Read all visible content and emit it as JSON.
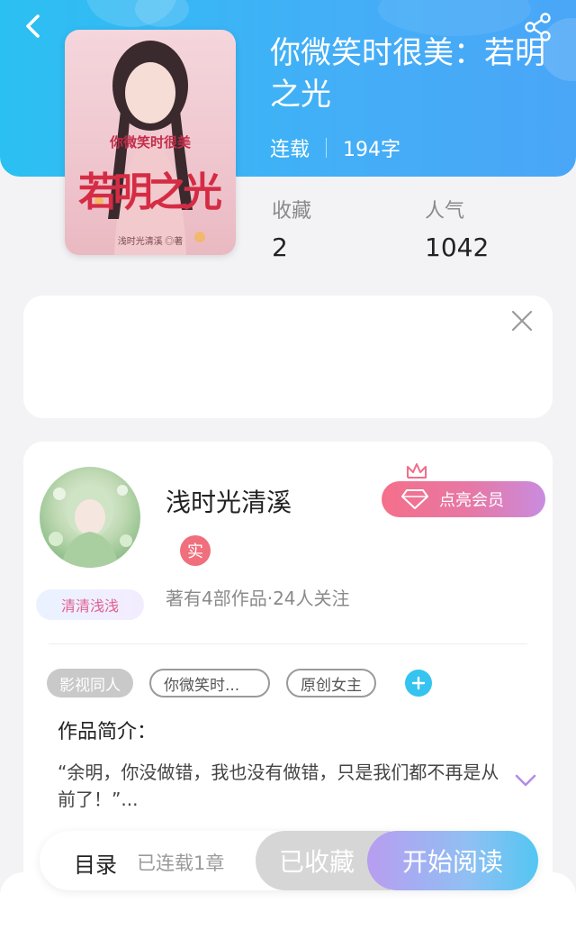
{
  "book": {
    "title": "你微笑时很美：若明之光",
    "status": "连载",
    "word_count": "194字",
    "cover": {
      "top_title": "你微笑时很美",
      "big_title": "若明之光",
      "author_line": "浅时光清溪 ◎著"
    }
  },
  "stats": {
    "favorites_label": "收藏",
    "favorites_value": "2",
    "popularity_label": "人气",
    "popularity_value": "1042"
  },
  "author": {
    "name": "浅时光清溪",
    "badge": "清清浅浅",
    "real_name_badge": "实",
    "meta": "著有4部作品·24人关注",
    "vip_label": "点亮会员"
  },
  "tags": [
    "影视同人",
    "你微笑时...",
    "原创女主"
  ],
  "intro": {
    "title": "作品简介：",
    "text": "“余明，你没做错，我也没有做错，只是我们都不再是从前了！”..."
  },
  "bottom_bar": {
    "toc_label": "目录",
    "chapters_label": "已连载1章",
    "favorited_label": "已收藏",
    "read_label": "开始阅读"
  },
  "colors": {
    "header_gradient_start": "#2bc0f2",
    "header_gradient_end": "#4aa6f7",
    "vip_gradient_start": "#f56f8a",
    "vip_gradient_end": "#c98cdf",
    "accent_blue": "#35c3f0"
  },
  "icons": [
    "back-icon",
    "share-icon",
    "close-icon",
    "diamond-icon",
    "crown-icon",
    "plus-icon",
    "chevron-down-icon"
  ]
}
